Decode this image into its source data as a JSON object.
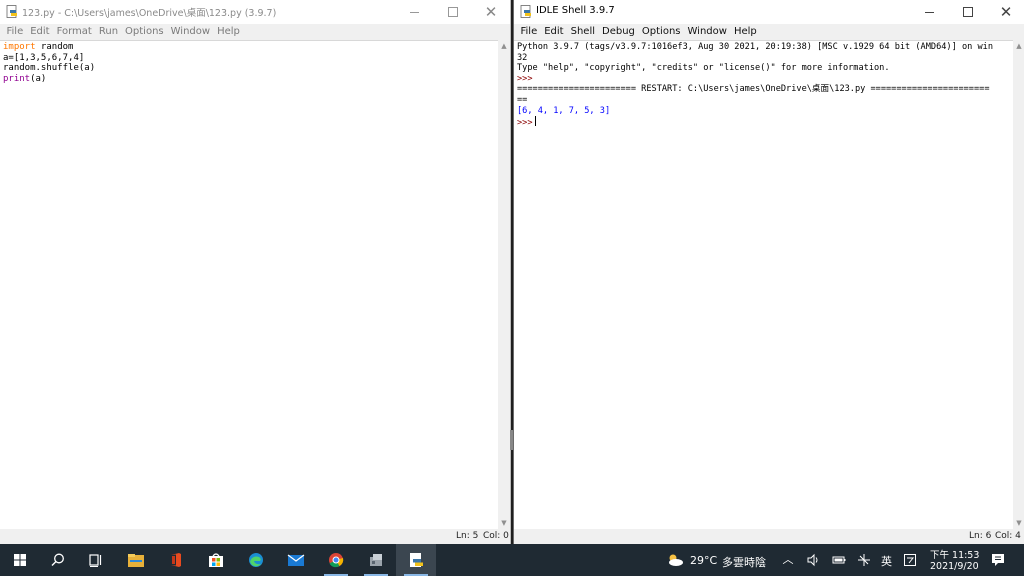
{
  "left_window": {
    "title": "123.py - C:\\Users\\james\\OneDrive\\桌面\\123.py (3.9.7)",
    "menu": [
      "File",
      "Edit",
      "Format",
      "Run",
      "Options",
      "Window",
      "Help"
    ],
    "code": {
      "l1_kw": "import",
      "l1_rest": " random",
      "l2": "a=[1,3,5,6,7,4]",
      "l3": "random.shuffle(a)",
      "l4_bi": "print",
      "l4_rest": "(a)"
    },
    "status": {
      "ln": "Ln: 5",
      "col": "Col: 0"
    }
  },
  "right_window": {
    "title": "IDLE Shell 3.9.7",
    "menu": [
      "File",
      "Edit",
      "Shell",
      "Debug",
      "Options",
      "Window",
      "Help"
    ],
    "shell": {
      "banner1": "Python 3.9.7 (tags/v3.9.7:1016ef3, Aug 30 2021, 20:19:38) [MSC v.1929 64 bit (AMD64)] on win",
      "banner2": "32",
      "banner3": "Type \"help\", \"copyright\", \"credits\" or \"license()\" for more information.",
      "prompt": ">>>",
      "restart1": "======================= RESTART: C:\\Users\\james\\OneDrive\\桌面\\123.py =======================",
      "restart2": "==",
      "output": "[6, 4, 1, 7, 5, 3]"
    },
    "status": {
      "ln": "Ln: 6",
      "col": "Col: 4"
    }
  },
  "taskbar": {
    "apps": [
      "start-icon",
      "search-icon",
      "task-view-icon",
      "file-explorer-icon",
      "office-icon",
      "store-icon",
      "edge-icon",
      "mail-icon",
      "chrome-icon",
      "app-icon",
      "idle-icon"
    ],
    "weather": {
      "temp": "29°C",
      "desc": "多雲時陰"
    },
    "ime": "英",
    "time": "下午 11:53",
    "date": "2021/9/20"
  }
}
